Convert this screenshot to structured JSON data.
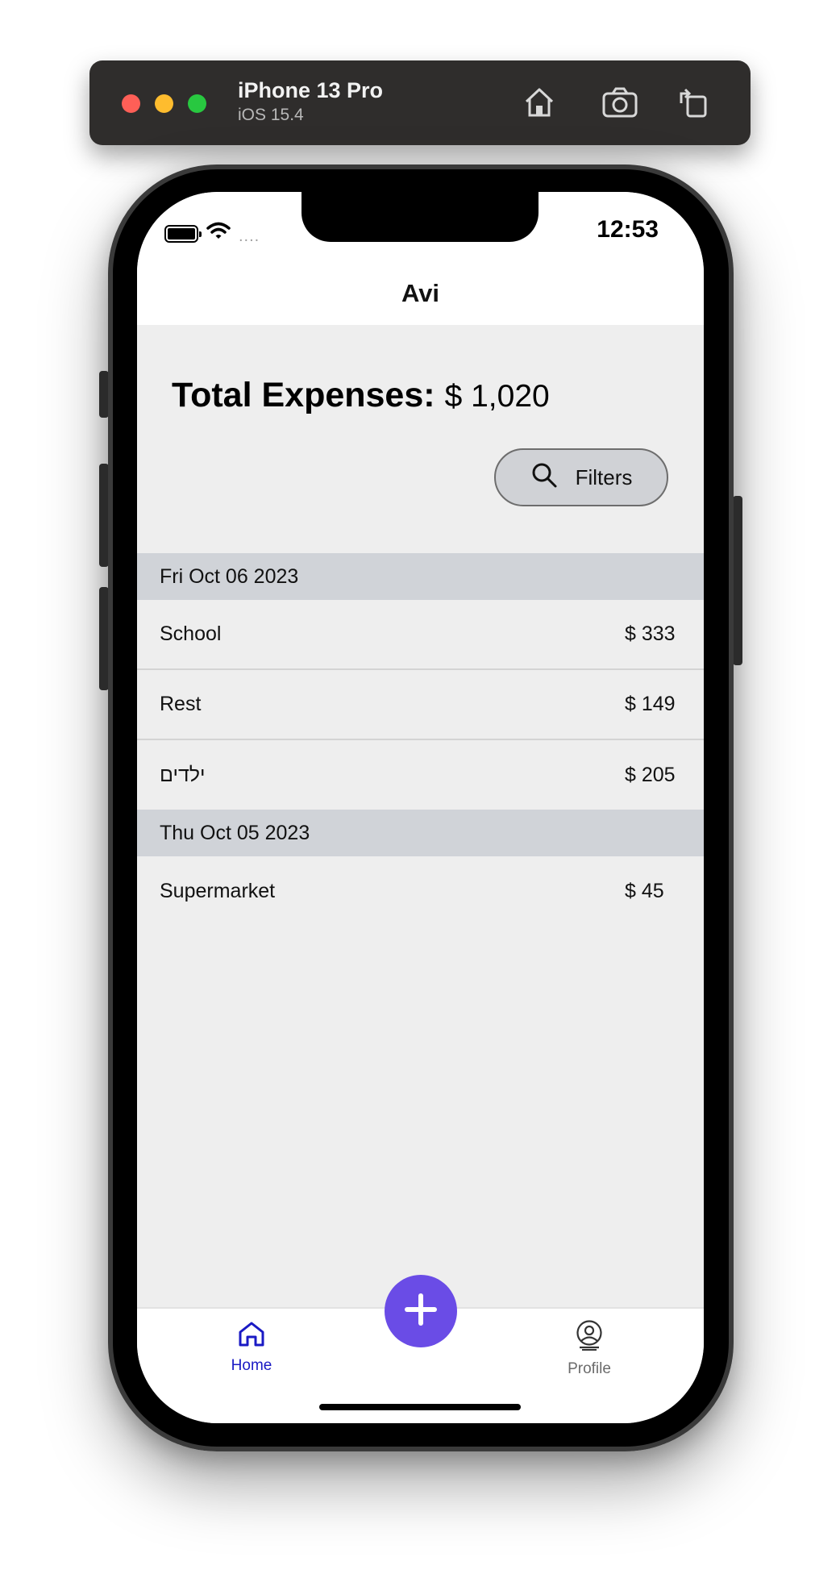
{
  "simulator": {
    "device_name": "iPhone 13 Pro",
    "os_version": "iOS 15.4",
    "icons": [
      "home-icon",
      "screenshot-icon",
      "rotate-icon"
    ]
  },
  "status_bar": {
    "time": "12:53",
    "signal": "...."
  },
  "header": {
    "title": "Avi"
  },
  "summary": {
    "total_label": "Total Expenses:",
    "total_value": "$ 1,020"
  },
  "filters": {
    "label": "Filters",
    "icon": "search-icon"
  },
  "sections": [
    {
      "date": "Fri Oct 06 2023",
      "items": [
        {
          "name": "School",
          "amount": "$ 333"
        },
        {
          "name": "Rest",
          "amount": "$ 149"
        },
        {
          "name": "ילדים",
          "amount": "$ 205"
        }
      ]
    },
    {
      "date": "Thu Oct 05 2023",
      "items": [
        {
          "name": "Supermarket",
          "amount": "$ 45"
        }
      ]
    }
  ],
  "tabbar": {
    "home_label": "Home",
    "profile_label": "Profile",
    "add_icon": "plus-icon",
    "active_color": "#1a1ac4",
    "fab_color": "#6a4ce6"
  }
}
